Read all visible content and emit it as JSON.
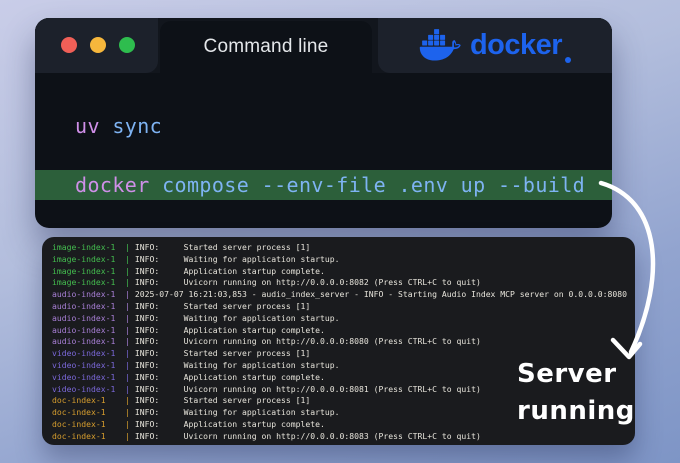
{
  "window": {
    "tab_title": "Command line",
    "brand_label": "docker",
    "traffic_lights": [
      {
        "name": "close",
        "color": "#f05f57"
      },
      {
        "name": "minimize",
        "color": "#f6b73c"
      },
      {
        "name": "maximize",
        "color": "#2ebd4e"
      }
    ]
  },
  "colors": {
    "docker_blue": "#1d63ed",
    "command_highlight": "#2c5f3a",
    "tokens": {
      "purple": "#cf8fe8",
      "blue": "#7eb3f2"
    },
    "log_background": "#1a1b1e",
    "log_text": "#e7e4db",
    "annotation_white": "#ffffff"
  },
  "terminal": {
    "commands": [
      {
        "highlighted": false,
        "tokens": [
          {
            "text": "uv",
            "color": "purple"
          },
          {
            "text": " sync",
            "color": "blue"
          }
        ]
      },
      {
        "highlighted": true,
        "tokens": [
          {
            "text": "docker",
            "color": "purple"
          },
          {
            "text": " compose --env-file .env up --build",
            "color": "blue"
          }
        ]
      }
    ]
  },
  "logs": {
    "service_colors": {
      "image-index-1": "#44bd4f",
      "audio-index-1": "#a87fd6",
      "video-index-1": "#7b68d9",
      "doc-index-1": "#d79e2e"
    },
    "entries": [
      {
        "service": "image-index-1",
        "message": "INFO:     Started server process [1]"
      },
      {
        "service": "image-index-1",
        "message": "INFO:     Waiting for application startup."
      },
      {
        "service": "image-index-1",
        "message": "INFO:     Application startup complete."
      },
      {
        "service": "image-index-1",
        "message": "INFO:     Uvicorn running on http://0.0.0.0:8082 (Press CTRL+C to quit)"
      },
      {
        "service": "audio-index-1",
        "message": "2025-07-07 16:21:03,853 - audio_index_server - INFO - Starting Audio Index MCP server on 0.0.0.0:8080"
      },
      {
        "service": "audio-index-1",
        "message": "INFO:     Started server process [1]"
      },
      {
        "service": "audio-index-1",
        "message": "INFO:     Waiting for application startup."
      },
      {
        "service": "audio-index-1",
        "message": "INFO:     Application startup complete."
      },
      {
        "service": "audio-index-1",
        "message": "INFO:     Uvicorn running on http://0.0.0.0:8080 (Press CTRL+C to quit)"
      },
      {
        "service": "video-index-1",
        "message": "INFO:     Started server process [1]"
      },
      {
        "service": "video-index-1",
        "message": "INFO:     Waiting for application startup."
      },
      {
        "service": "video-index-1",
        "message": "INFO:     Application startup complete."
      },
      {
        "service": "video-index-1",
        "message": "INFO:     Uvicorn running on http://0.0.0.0:8081 (Press CTRL+C to quit)"
      },
      {
        "service": "doc-index-1",
        "message": "INFO:     Started server process [1]"
      },
      {
        "service": "doc-index-1",
        "message": "INFO:     Waiting for application startup."
      },
      {
        "service": "doc-index-1",
        "message": "INFO:     Application startup complete."
      },
      {
        "service": "doc-index-1",
        "message": "INFO:     Uvicorn running on http://0.0.0.0:8083 (Press CTRL+C to quit)"
      }
    ]
  },
  "annotation": {
    "lines": [
      "Server",
      "running"
    ]
  }
}
